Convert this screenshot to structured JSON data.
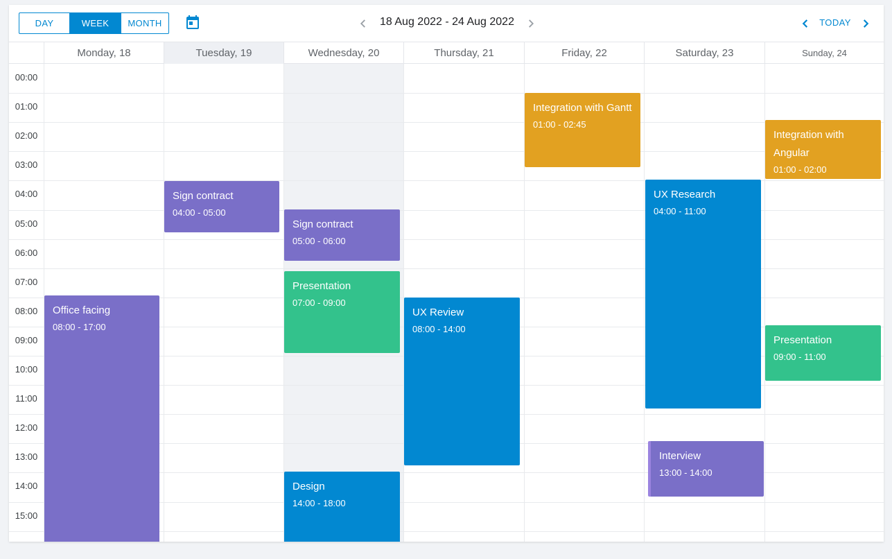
{
  "toolbar": {
    "modes": [
      "DAY",
      "WEEK",
      "MONTH"
    ],
    "active_mode": "WEEK",
    "date_range": "18 Aug 2022 - 24 Aug 2022",
    "today_label": "TODAY"
  },
  "days": [
    {
      "label": "Monday, 18"
    },
    {
      "label": "Tuesday, 19"
    },
    {
      "label": "Wednesday, 20"
    },
    {
      "label": "Thursday, 21"
    },
    {
      "label": "Friday, 22"
    },
    {
      "label": "Saturday, 23"
    },
    {
      "label": "Sunday, 24"
    }
  ],
  "hours": [
    "00:00",
    "01:00",
    "02:00",
    "03:00",
    "04:00",
    "05:00",
    "06:00",
    "07:00",
    "08:00",
    "09:00",
    "10:00",
    "11:00",
    "12:00",
    "13:00",
    "14:00",
    "15:00"
  ],
  "events": [
    {
      "day": 0,
      "title": "Office facing",
      "time": "08:00 - 17:00",
      "color": "#7a6fc8"
    },
    {
      "day": 1,
      "title": "Sign contract",
      "time": "04:00 - 05:00",
      "color": "#7a6fc8"
    },
    {
      "day": 2,
      "title": "Sign contract",
      "time": "05:00 - 06:00",
      "color": "#7a6fc8"
    },
    {
      "day": 2,
      "title": "Presentation",
      "time": "07:00 - 09:00",
      "color": "#33c28c"
    },
    {
      "day": 2,
      "title": "Design",
      "time": "14:00 - 18:00",
      "color": "#0288d1"
    },
    {
      "day": 3,
      "title": "UX Review",
      "time": "08:00 - 14:00",
      "color": "#0288d1"
    },
    {
      "day": 4,
      "title": "Integration with Gantt",
      "time": "01:00 - 02:45",
      "color": "#e2a121"
    },
    {
      "day": 5,
      "title": "UX Research",
      "time": "04:00 - 11:00",
      "color": "#0288d1"
    },
    {
      "day": 5,
      "title": "Interview",
      "time": "13:00 - 14:00",
      "color": "#7a6fc8"
    },
    {
      "day": 6,
      "title": "Integration with Angular",
      "time": "01:00 - 02:00",
      "color": "#e2a121"
    },
    {
      "day": 6,
      "title": "Presentation",
      "time": "09:00 - 11:00",
      "color": "#33c28c"
    }
  ]
}
